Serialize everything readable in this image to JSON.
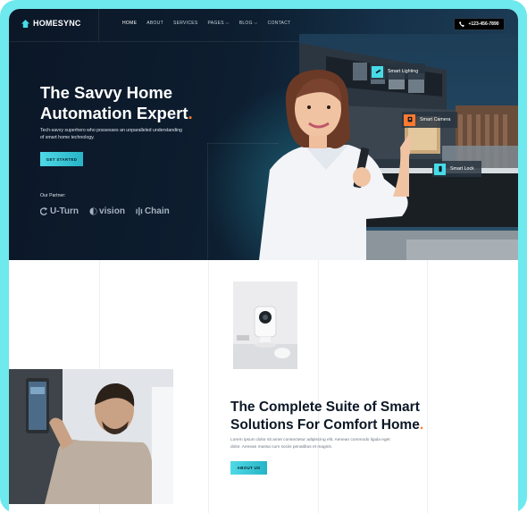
{
  "brand": {
    "name": "HOMESYNC"
  },
  "nav": {
    "items": [
      "HOME",
      "ABOUT",
      "SERVICES",
      "PAGES ⌵",
      "BLOG ⌵",
      "CONTACT"
    ],
    "phone": "+123-456-7890"
  },
  "hero": {
    "title_line1": "The Savvy Home",
    "title_line2": "Automation Expert",
    "title_dot": ".",
    "subtitle": "Tech-savvy superhero who possesses an unparalleled understanding of smart home technology.",
    "cta_label": "GET STARTED",
    "partner_label": "Our Partner:",
    "partners": [
      "U-Turn",
      "vision",
      "Chain"
    ]
  },
  "features": {
    "lighting": "Smart Lighting",
    "camera": "Smart Camera",
    "lock": "Smart Lock"
  },
  "about": {
    "title_line1": "The Complete Suite of Smart",
    "title_line2": "Solutions For Comfort Home",
    "title_dot": ".",
    "text": "Lorem ipsum dolor sit amet consectetur adipiscing elit. Aenean commodo ligula eget dolor. Aenean massa cum sociis penatibus et magnis.",
    "button_label": "ABOUT US"
  },
  "colors": {
    "accent": "#47dbe6",
    "highlight": "#ff7a2f",
    "dark": "#0b1727"
  }
}
